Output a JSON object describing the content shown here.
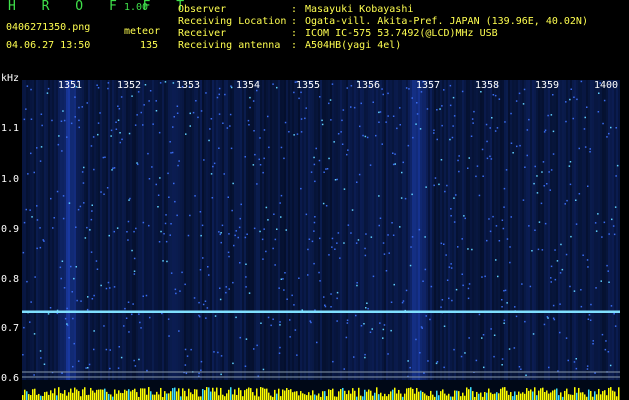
{
  "header": {
    "title": "H R O F F T",
    "version": "1.00",
    "filename": "0406271350.png",
    "mode": "meteor",
    "datetime": "04.06.27 13:50",
    "count": "135"
  },
  "info": [
    {
      "label": "Observer",
      "value": "Masayuki Kobayashi"
    },
    {
      "label": "Receiving Location",
      "value": "Ogata-vill. Akita-Pref. JAPAN (139.96E, 40.02N)"
    },
    {
      "label": "Receiver",
      "value": "ICOM IC-575 53.7492(@LCD)MHz USB"
    },
    {
      "label": "Receiving antenna",
      "value": "A504HB(yagi 4el)"
    }
  ],
  "axis": {
    "unit": "kHz",
    "minutes": [
      "1351",
      "1352",
      "1353",
      "1354",
      "1355",
      "1356",
      "1357",
      "1358",
      "1359",
      "1400"
    ],
    "freq_ticks": [
      "1.1",
      "1.0",
      "0.9",
      "0.8",
      "0.7",
      "0.6"
    ]
  },
  "spectrogram": {
    "carrier_khz": 0.735,
    "bright_columns_minutes": [
      1351,
      1357
    ],
    "colors": {
      "background": "#000817",
      "noise": "#1c3fb0",
      "carrier": "#7fe0ff",
      "baseline": "#ffff00"
    }
  }
}
